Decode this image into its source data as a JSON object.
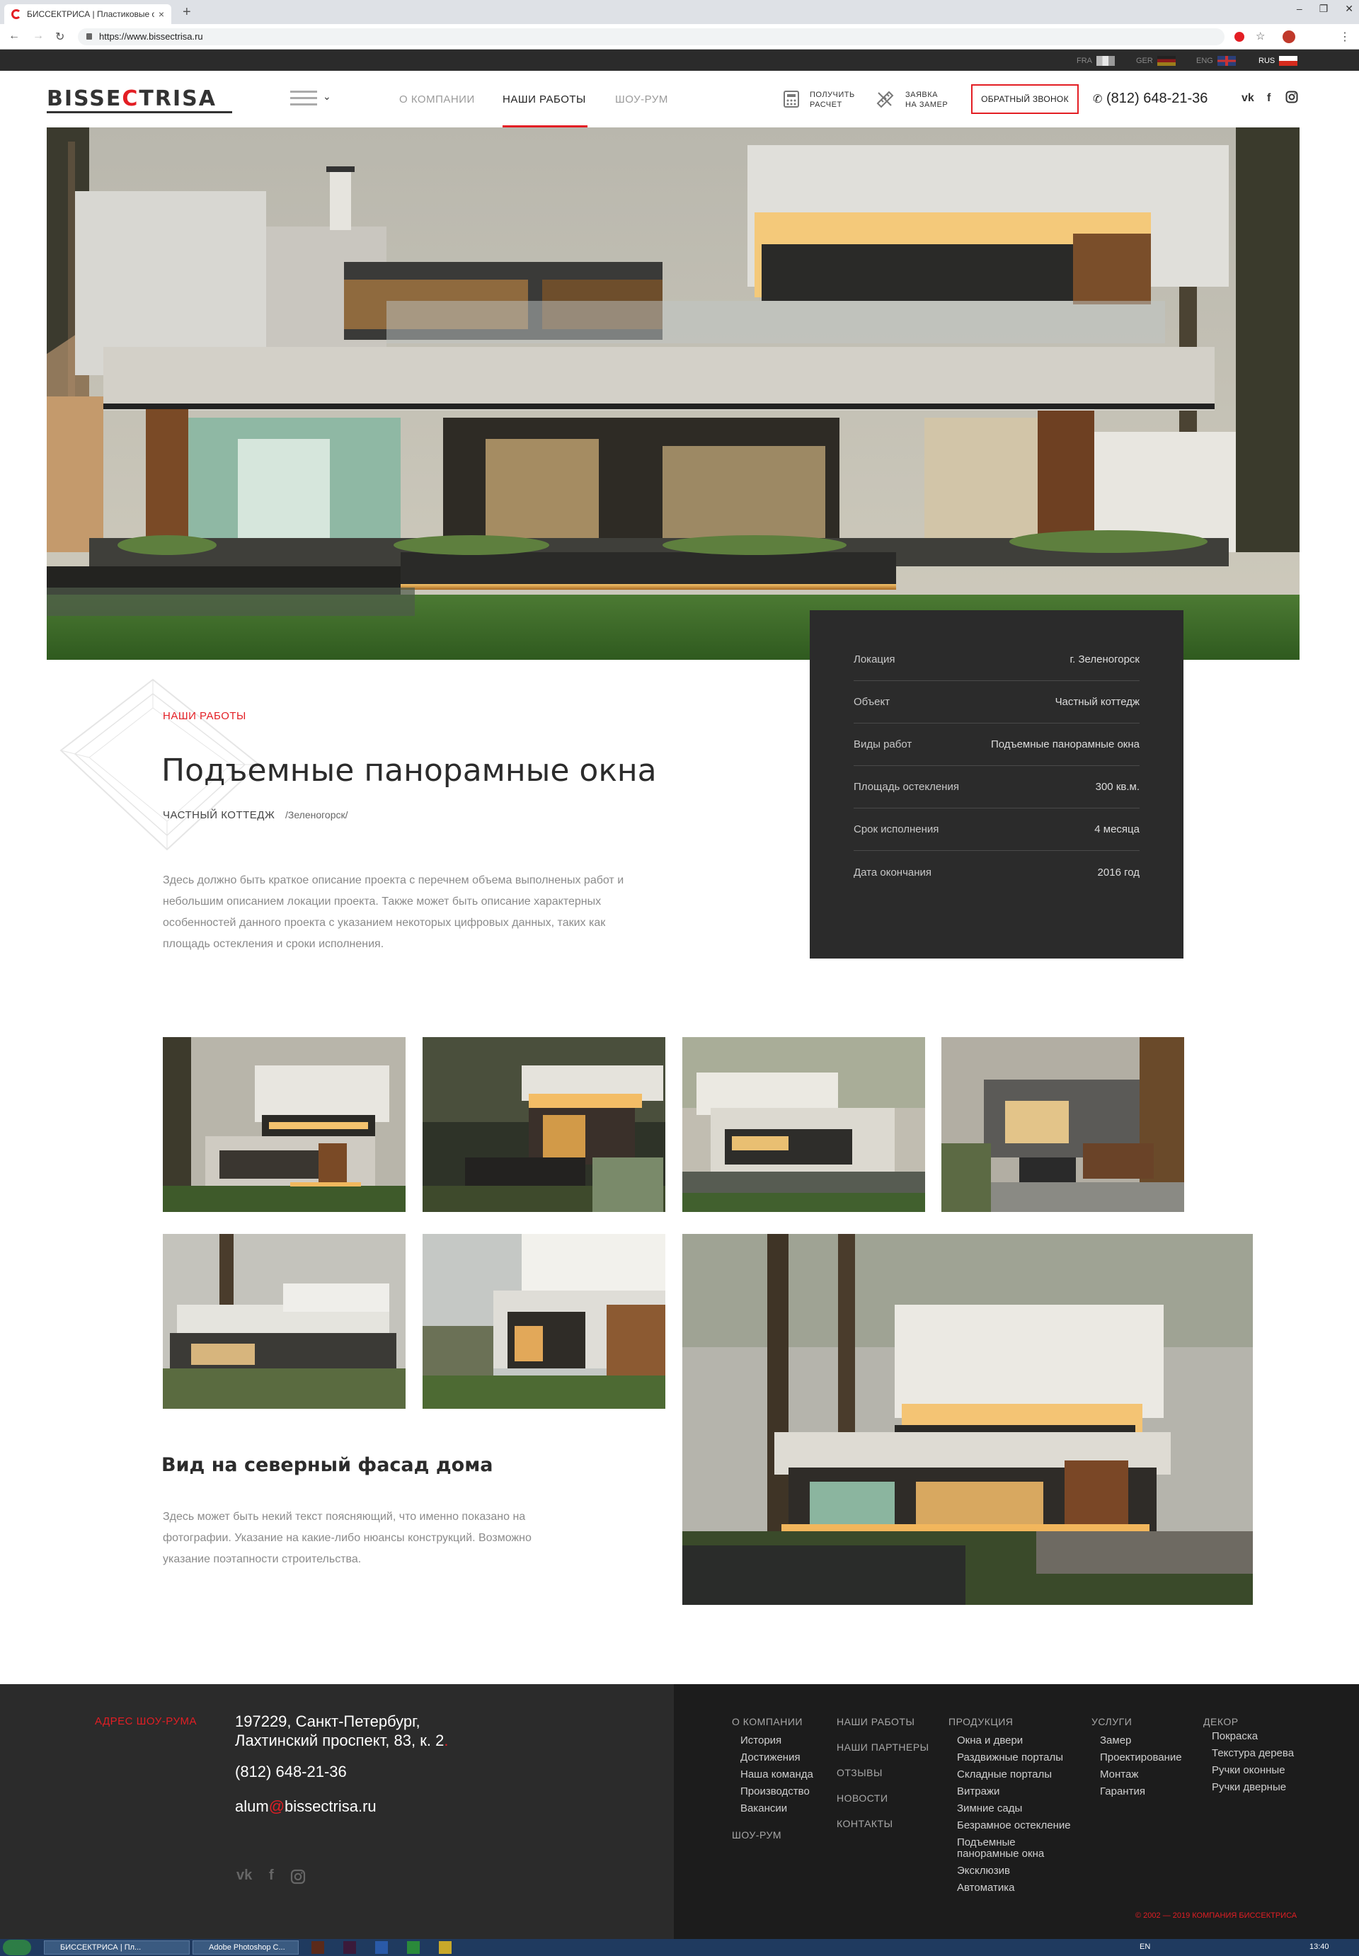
{
  "browser": {
    "tab_title": "БИССЕКТРИСА | Пластиковые о",
    "tab_close": "×",
    "new_tab": "+",
    "url": "https://www.bissectrisa.ru"
  },
  "languages": [
    {
      "code": "FRA",
      "active": false
    },
    {
      "code": "GER",
      "active": false
    },
    {
      "code": "ENG",
      "active": false
    },
    {
      "code": "RUS",
      "active": true
    }
  ],
  "header": {
    "logo_left": "BISSE",
    "logo_mid": "C",
    "logo_right": "TRISA",
    "nav": [
      "О КОМПАНИИ",
      "НАШИ РАБОТЫ",
      "ШОУ-РУМ"
    ],
    "active_nav": "НАШИ РАБОТЫ",
    "calc_label_1": "ПОЛУЧИТЬ",
    "calc_label_2": "РАСЧЕТ",
    "measure_label_1": "ЗАЯВКА",
    "measure_label_2": "НА ЗАМЕР",
    "callback_button": "ОБРАТНЫЙ ЗВОНОК",
    "phone": "(812) 648-21-36",
    "brand_color": "#e31e24"
  },
  "project": {
    "kicker": "НАШИ РАБОТЫ",
    "title": "Подъемные панорамные окна",
    "type": "ЧАСТНЫЙ КОТТЕДЖ",
    "location": "/Зеленогорск/",
    "description": "Здесь должно быть краткое описание проекта с перечнем объема выполненых работ и небольшим описанием локации проекта. Также может быть описание характерных особенностей данного проекта с указанием некоторых цифровых данных, таких как площадь остекления и сроки исполнения."
  },
  "info": [
    {
      "label": "Локация",
      "value": "г. Зеленогорск"
    },
    {
      "label": "Объект",
      "value": "Частный коттедж"
    },
    {
      "label": "Виды работ",
      "value": "Подъемные панорамные окна"
    },
    {
      "label": "Площадь остекления",
      "value": "300 кв.м."
    },
    {
      "label": "Срок исполнения",
      "value": "4 месяца"
    },
    {
      "label": "Дата окончания",
      "value": "2016 год"
    }
  ],
  "gallery": {
    "title": "Вид на северный фасад дома",
    "description": "Здесь может быть некий текст поясняющий, что именно показано на фотографии. Указание на какие-либо нюансы конструкций. Возможно указание поэтапности строительства."
  },
  "footer": {
    "showroom_label": "АДРЕС ШОУ-РУМА",
    "address_line1": "197229, Санкт-Петербург,",
    "address_line2": "Лахтинский проспект, 83, к. 2",
    "address_dot": ".",
    "phone": "(812) 648-21-36",
    "email_user": "alum",
    "email_at": "@",
    "email_domain": "bissectrisa.ru",
    "col_company": {
      "title": "О КОМПАНИИ",
      "items": [
        "История",
        "Достижения",
        "Наша команда",
        "Производство",
        "Вакансии"
      ],
      "extra": "ШОУ-РУМ"
    },
    "col_works": {
      "items": [
        "НАШИ РАБОТЫ",
        "НАШИ ПАРТНЕРЫ",
        "ОТЗЫВЫ",
        "НОВОСТИ",
        "КОНТАКТЫ"
      ]
    },
    "col_products": {
      "title": "ПРОДУКЦИЯ",
      "items": [
        "Окна и двери",
        "Раздвижные порталы",
        "Складные порталы",
        "Витражи",
        "Зимние сады",
        "Безрамное остекление",
        "Подъемные",
        "панорамные окна",
        "Эксклюзив",
        "Автоматика"
      ]
    },
    "col_services": {
      "title": "УСЛУГИ",
      "items": [
        "Замер",
        "Проектирование",
        "Монтаж",
        "Гарантия"
      ]
    },
    "col_decor": {
      "title": "ДЕКОР",
      "items": [
        "Покраска",
        "Текстура дерева",
        "Ручки оконные",
        "Ручки дверные"
      ]
    },
    "copyright": "© 2002 — 2019 КОМПАНИЯ БИССЕКТРИСА"
  },
  "taskbar": {
    "items": [
      "БИССЕКТРИСА | Пл...",
      "Adobe Photoshop C..."
    ],
    "lang": "EN",
    "clock": "13:40"
  }
}
